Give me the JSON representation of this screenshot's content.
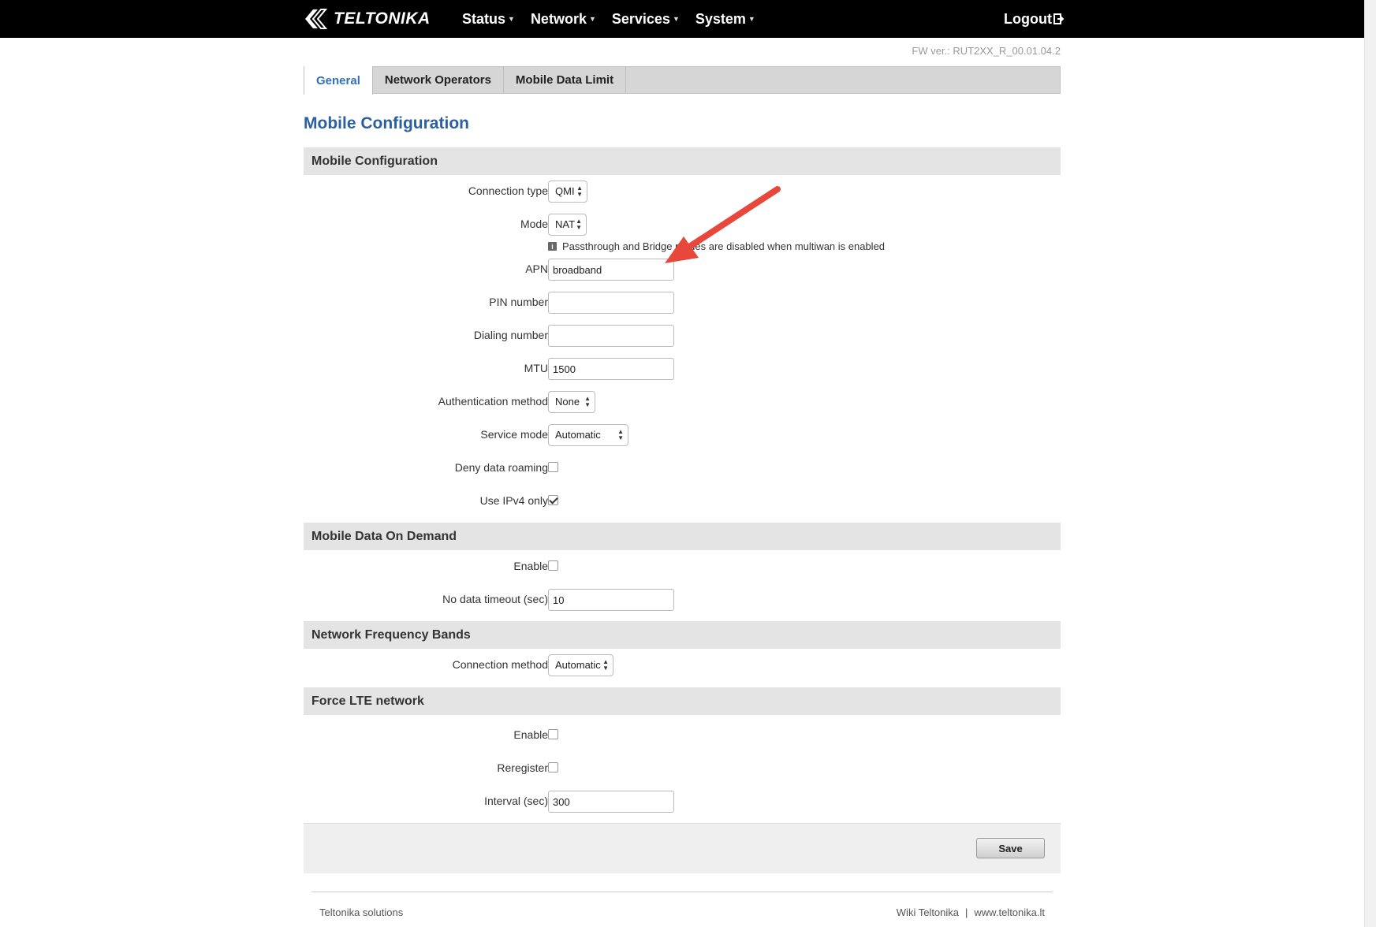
{
  "brand": {
    "logo_text": "TELTONIKA"
  },
  "nav": {
    "items": [
      {
        "label": "Status"
      },
      {
        "label": "Network"
      },
      {
        "label": "Services"
      },
      {
        "label": "System"
      }
    ],
    "logout": "Logout"
  },
  "firmware": "FW ver.: RUT2XX_R_00.01.04.2",
  "tabs": [
    {
      "label": "General",
      "active": true
    },
    {
      "label": "Network Operators",
      "active": false
    },
    {
      "label": "Mobile Data Limit",
      "active": false
    }
  ],
  "page_title": "Mobile Configuration",
  "sections": {
    "mobile_config": {
      "title": "Mobile Configuration",
      "connection_type": {
        "label": "Connection type",
        "value": "QMI"
      },
      "mode": {
        "label": "Mode",
        "value": "NAT"
      },
      "note": "Passthrough and Bridge modes are disabled when multiwan is enabled",
      "apn": {
        "label": "APN",
        "value": "broadband"
      },
      "pin": {
        "label": "PIN number",
        "value": ""
      },
      "dialing": {
        "label": "Dialing number",
        "value": ""
      },
      "mtu": {
        "label": "MTU",
        "value": "1500"
      },
      "auth": {
        "label": "Authentication method",
        "value": "None"
      },
      "service_mode": {
        "label": "Service mode",
        "value": "Automatic"
      },
      "deny_roaming": {
        "label": "Deny data roaming",
        "checked": false
      },
      "ipv4_only": {
        "label": "Use IPv4 only",
        "checked": true
      }
    },
    "on_demand": {
      "title": "Mobile Data On Demand",
      "enable": {
        "label": "Enable",
        "checked": false
      },
      "timeout": {
        "label": "No data timeout (sec)",
        "value": "10"
      }
    },
    "bands": {
      "title": "Network Frequency Bands",
      "method": {
        "label": "Connection method",
        "value": "Automatic"
      }
    },
    "force_lte": {
      "title": "Force LTE network",
      "enable": {
        "label": "Enable",
        "checked": false
      },
      "reregister": {
        "label": "Reregister",
        "checked": false
      },
      "interval": {
        "label": "Interval (sec)",
        "value": "300"
      }
    }
  },
  "save_label": "Save",
  "footer": {
    "left": "Teltonika solutions",
    "wiki": "Wiki Teltonika",
    "separator": "|",
    "site": "www.teltonika.lt"
  },
  "colors": {
    "accent": "#2a5fa0",
    "tab_active": "#2e72b8",
    "annotation_arrow": "#e8473b"
  }
}
